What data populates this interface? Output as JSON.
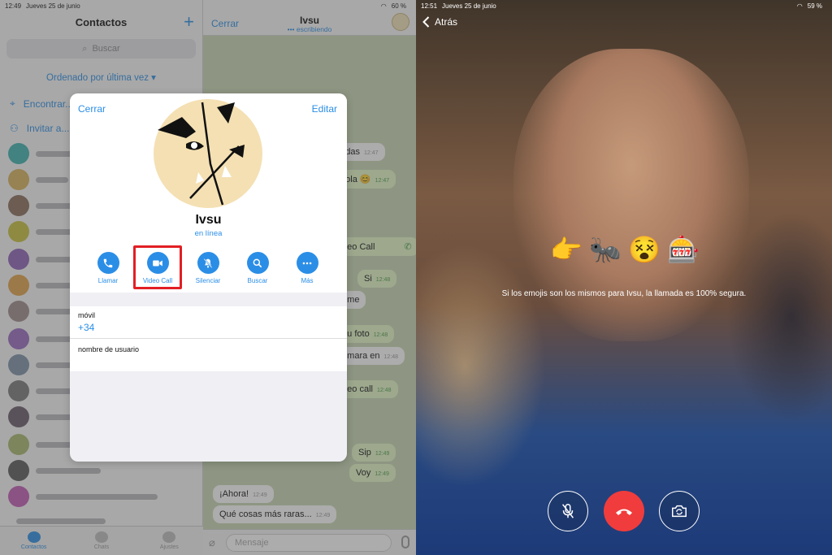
{
  "left_screen": {
    "status": {
      "time": "12:49",
      "date": "Jueves 25 de junio",
      "battery": "60 %"
    },
    "contacts": {
      "title": "Contactos",
      "add_icon": "plus-icon",
      "search_placeholder": "Buscar",
      "sort_label": "Ordenado por última vez ▾",
      "find_people": "Encontrar...",
      "invite": "Invitar a...",
      "tabs": [
        {
          "label": "Contactos",
          "icon": "person-circle-icon"
        },
        {
          "label": "Chats",
          "icon": "chat-bubbles-icon"
        },
        {
          "label": "Ajustes",
          "icon": "gear-icon"
        }
      ]
    },
    "chat": {
      "close_label": "Cerrar",
      "contact_name": "Ivsu",
      "typing_status": "••• escribiendo",
      "messages": [
        {
          "text": "...adas",
          "time": "12:47",
          "dir": "in"
        },
        {
          "text": "...ola 😊",
          "time": "12:47",
          "dir": "out"
        },
        {
          "text": "...eo Call",
          "time": "",
          "dir": "out"
        },
        {
          "text": "Si",
          "time": "12:48",
          "dir": "out"
        },
        {
          "text": "...me",
          "time": "",
          "dir": "in"
        },
        {
          "text": "...u foto",
          "time": "12:48",
          "dir": "out"
        },
        {
          "text": "...mara en",
          "time": "12:48",
          "dir": "in"
        },
        {
          "text": "...eo call",
          "time": "12:48",
          "dir": "out"
        },
        {
          "text": "Sip",
          "time": "12:49",
          "dir": "out"
        },
        {
          "text": "Voy",
          "time": "12:49",
          "dir": "out"
        },
        {
          "text": "¡Ahora!",
          "time": "12:49",
          "dir": "in"
        },
        {
          "text": "Qué cosas más raras...",
          "time": "12:49",
          "dir": "in"
        }
      ],
      "input_placeholder": "Mensaje"
    },
    "profile_modal": {
      "close_label": "Cerrar",
      "edit_label": "Editar",
      "name": "Ivsu",
      "status": "en línea",
      "actions": [
        {
          "label": "Llamar",
          "icon": "phone-icon"
        },
        {
          "label": "Video Call",
          "icon": "video-camera-icon"
        },
        {
          "label": "Silenciar",
          "icon": "bell-slash-icon"
        },
        {
          "label": "Buscar",
          "icon": "magnifier-icon"
        },
        {
          "label": "Más",
          "icon": "ellipsis-icon"
        }
      ],
      "phone_label": "móvil",
      "phone_value": "+34",
      "username_label": "nombre de usuario"
    }
  },
  "right_screen": {
    "status": {
      "time": "12:51",
      "date": "Jueves 25 de junio",
      "battery": "59 %"
    },
    "back_label": "Atrás",
    "emojis": [
      "👉",
      "🐜",
      "😵",
      "🎰"
    ],
    "security_note": "Si los emojis son los mismos para Ivsu, la llamada es 100% segura.",
    "controls": [
      {
        "name": "mute",
        "icon": "mic-slash-icon"
      },
      {
        "name": "end",
        "icon": "hangup-icon"
      },
      {
        "name": "switch-camera",
        "icon": "camera-rotate-icon"
      }
    ],
    "colors": {
      "end_call": "#f03c3c",
      "accent": "#2b8ee6",
      "highlight": "#e21f24"
    }
  }
}
